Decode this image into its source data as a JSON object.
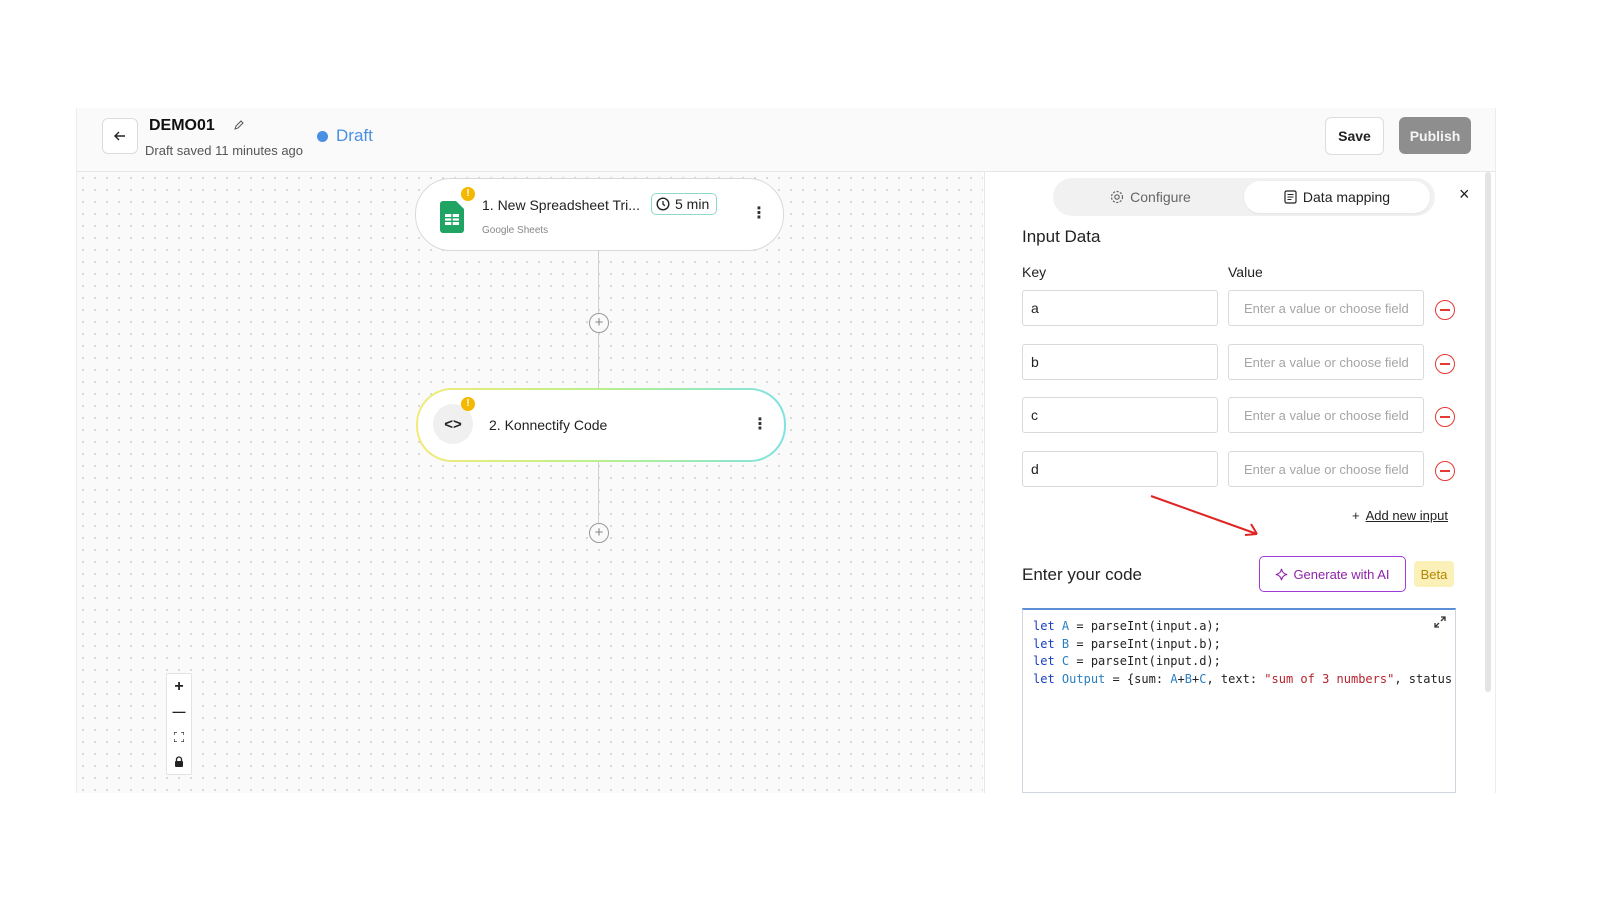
{
  "header": {
    "workflow_name": "DEMO01",
    "saved_text": "Draft saved 11 minutes ago",
    "status": "Draft",
    "save_label": "Save",
    "publish_label": "Publish",
    "status_color": "#4a90e2"
  },
  "canvas": {
    "nodes": [
      {
        "title": "1. New Spreadsheet Tri...",
        "app": "Google Sheets",
        "badge": "5 min",
        "icon": "google-sheets-icon",
        "warning": "!"
      },
      {
        "title": "2. Konnectify Code",
        "icon": "code-icon",
        "warning": "!"
      }
    ],
    "kebab": "⋮",
    "add_step": "+",
    "zoom_controls": {
      "zoom_in": "+",
      "zoom_out": "—",
      "fit": "⛶",
      "lock": "🔒"
    }
  },
  "panel": {
    "tabs": [
      {
        "label": "Configure",
        "icon": "gear-icon",
        "active": false
      },
      {
        "label": "Data mapping",
        "icon": "document-icon",
        "active": true
      }
    ],
    "close": "×",
    "input_data_title": "Input Data",
    "key_header": "Key",
    "value_header": "Value",
    "inputs": [
      {
        "key": "a",
        "value_placeholder": "Enter a value or choose field"
      },
      {
        "key": "b",
        "value_placeholder": "Enter a value or choose field"
      },
      {
        "key": "c",
        "value_placeholder": "Enter a value or choose field"
      },
      {
        "key": "d",
        "value_placeholder": "Enter a value or choose field"
      }
    ],
    "add_new_input": "Add new input",
    "code_title": "Enter your code",
    "generate_ai_label": "Generate with AI",
    "beta_label": "Beta",
    "code_lines": [
      "let A = parseInt(input.a);",
      "let B = parseInt(input.b);",
      "let C = parseInt(input.d);",
      "let Output = {sum: A+B+C, text: \"sum of 3 numbers\", status:"
    ],
    "accent_color": "#a03bd9"
  }
}
